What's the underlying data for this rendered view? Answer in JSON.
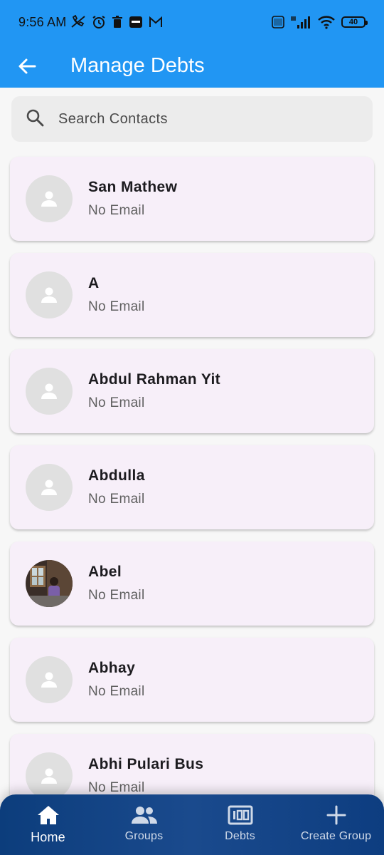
{
  "status_bar": {
    "time": "9:56 AM",
    "left_icons": [
      "mute-call-icon",
      "alarm-icon",
      "trash-icon",
      "note-app-icon",
      "gmail-icon"
    ],
    "battery": "40",
    "network": "4G+",
    "volte": "VoLTE"
  },
  "toolbar": {
    "title": "Manage Debts",
    "back_icon": "arrow-left-icon"
  },
  "search": {
    "placeholder": "Search Contacts",
    "value": ""
  },
  "contacts": [
    {
      "name": "San Mathew",
      "email": "No Email",
      "has_photo": false
    },
    {
      "name": "A",
      "email": "No Email",
      "has_photo": false
    },
    {
      "name": "Abdul Rahman Yit",
      "email": "No Email",
      "has_photo": false
    },
    {
      "name": "Abdulla",
      "email": "No Email",
      "has_photo": false
    },
    {
      "name": "Abel",
      "email": "No Email",
      "has_photo": true
    },
    {
      "name": "Abhay",
      "email": "No Email",
      "has_photo": false
    },
    {
      "name": "Abhi Pulari Bus",
      "email": "No Email",
      "has_photo": false
    }
  ],
  "bottom_nav": {
    "items": [
      {
        "label": "Home",
        "icon": "home-icon",
        "active": true
      },
      {
        "label": "Groups",
        "icon": "groups-icon",
        "active": false
      },
      {
        "label": "Debts",
        "icon": "debts-icon",
        "active": false
      },
      {
        "label": "Create Group",
        "icon": "plus-icon",
        "active": false
      }
    ]
  },
  "colors": {
    "app_bar": "#2196f3",
    "card_bg": "#f7eff9",
    "nav_bg": "#1a4a8d"
  }
}
